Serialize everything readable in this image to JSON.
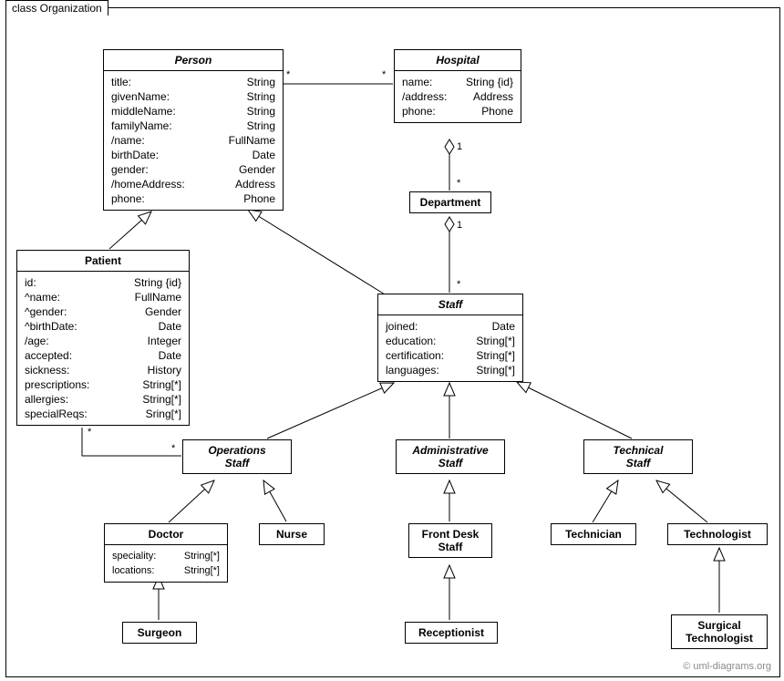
{
  "frame": {
    "title": "class Organization"
  },
  "copyright": "© uml-diagrams.org",
  "classes": {
    "person": {
      "name": "Person",
      "attrs": [
        {
          "n": "title:",
          "t": "String"
        },
        {
          "n": "givenName:",
          "t": "String"
        },
        {
          "n": "middleName:",
          "t": "String"
        },
        {
          "n": "familyName:",
          "t": "String"
        },
        {
          "n": "/name:",
          "t": "FullName"
        },
        {
          "n": "birthDate:",
          "t": "Date"
        },
        {
          "n": "gender:",
          "t": "Gender"
        },
        {
          "n": "/homeAddress:",
          "t": "Address"
        },
        {
          "n": "phone:",
          "t": "Phone"
        }
      ]
    },
    "hospital": {
      "name": "Hospital",
      "attrs": [
        {
          "n": "name:",
          "t": "String {id}"
        },
        {
          "n": "/address:",
          "t": "Address"
        },
        {
          "n": "phone:",
          "t": "Phone"
        }
      ]
    },
    "department": {
      "name": "Department"
    },
    "patient": {
      "name": "Patient",
      "attrs": [
        {
          "n": "id:",
          "t": "String {id}"
        },
        {
          "n": "^name:",
          "t": "FullName"
        },
        {
          "n": "^gender:",
          "t": "Gender"
        },
        {
          "n": "^birthDate:",
          "t": "Date"
        },
        {
          "n": "/age:",
          "t": "Integer"
        },
        {
          "n": "accepted:",
          "t": "Date"
        },
        {
          "n": "sickness:",
          "t": "History"
        },
        {
          "n": "prescriptions:",
          "t": "String[*]"
        },
        {
          "n": "allergies:",
          "t": "String[*]"
        },
        {
          "n": "specialReqs:",
          "t": "Sring[*]"
        }
      ]
    },
    "staff": {
      "name": "Staff",
      "attrs": [
        {
          "n": "joined:",
          "t": "Date"
        },
        {
          "n": "education:",
          "t": "String[*]"
        },
        {
          "n": "certification:",
          "t": "String[*]"
        },
        {
          "n": "languages:",
          "t": "String[*]"
        }
      ]
    },
    "ops": {
      "name": "Operations",
      "sub": "Staff"
    },
    "admin": {
      "name": "Administrative",
      "sub": "Staff"
    },
    "tech": {
      "name": "Technical",
      "sub": "Staff"
    },
    "doctor": {
      "name": "Doctor",
      "attrs": [
        {
          "n": "speciality:",
          "t": "String[*]"
        },
        {
          "n": "locations:",
          "t": "String[*]"
        }
      ]
    },
    "nurse": {
      "name": "Nurse"
    },
    "frontdesk": {
      "name": "Front Desk",
      "sub": "Staff"
    },
    "technician": {
      "name": "Technician"
    },
    "technologist": {
      "name": "Technologist"
    },
    "surgeon": {
      "name": "Surgeon"
    },
    "receptionist": {
      "name": "Receptionist"
    },
    "surgtech": {
      "name": "Surgical",
      "sub": "Technologist"
    }
  },
  "mult": {
    "person_hosp_l": "*",
    "person_hosp_r": "*",
    "hosp_dept_1": "1",
    "hosp_dept_s": "*",
    "dept_staff_1": "1",
    "dept_staff_s": "*",
    "patient_ops_l": "*",
    "patient_ops_r": "*"
  }
}
